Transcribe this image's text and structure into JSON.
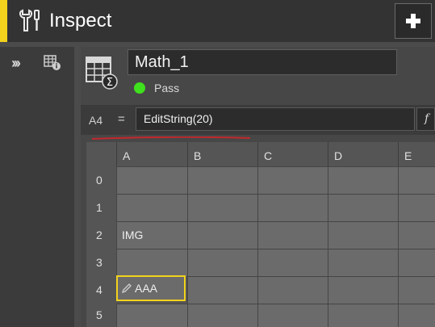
{
  "header": {
    "title": "Inspect"
  },
  "tool": {
    "name": "Math_1",
    "status": "Pass",
    "status_color": "#3fe01e"
  },
  "formula": {
    "cell_ref": "A4",
    "equals": "=",
    "value": "EditString(20)",
    "fx_label": "f"
  },
  "grid": {
    "columns": [
      "A",
      "B",
      "C",
      "D",
      "E"
    ],
    "rows": [
      "0",
      "1",
      "2",
      "3",
      "4",
      "5"
    ],
    "cells": {
      "A2": "IMG",
      "A4": "AAA"
    },
    "active_cell": "A4"
  },
  "colors": {
    "accent": "#f2d21c",
    "annotation": "#c0282d"
  }
}
